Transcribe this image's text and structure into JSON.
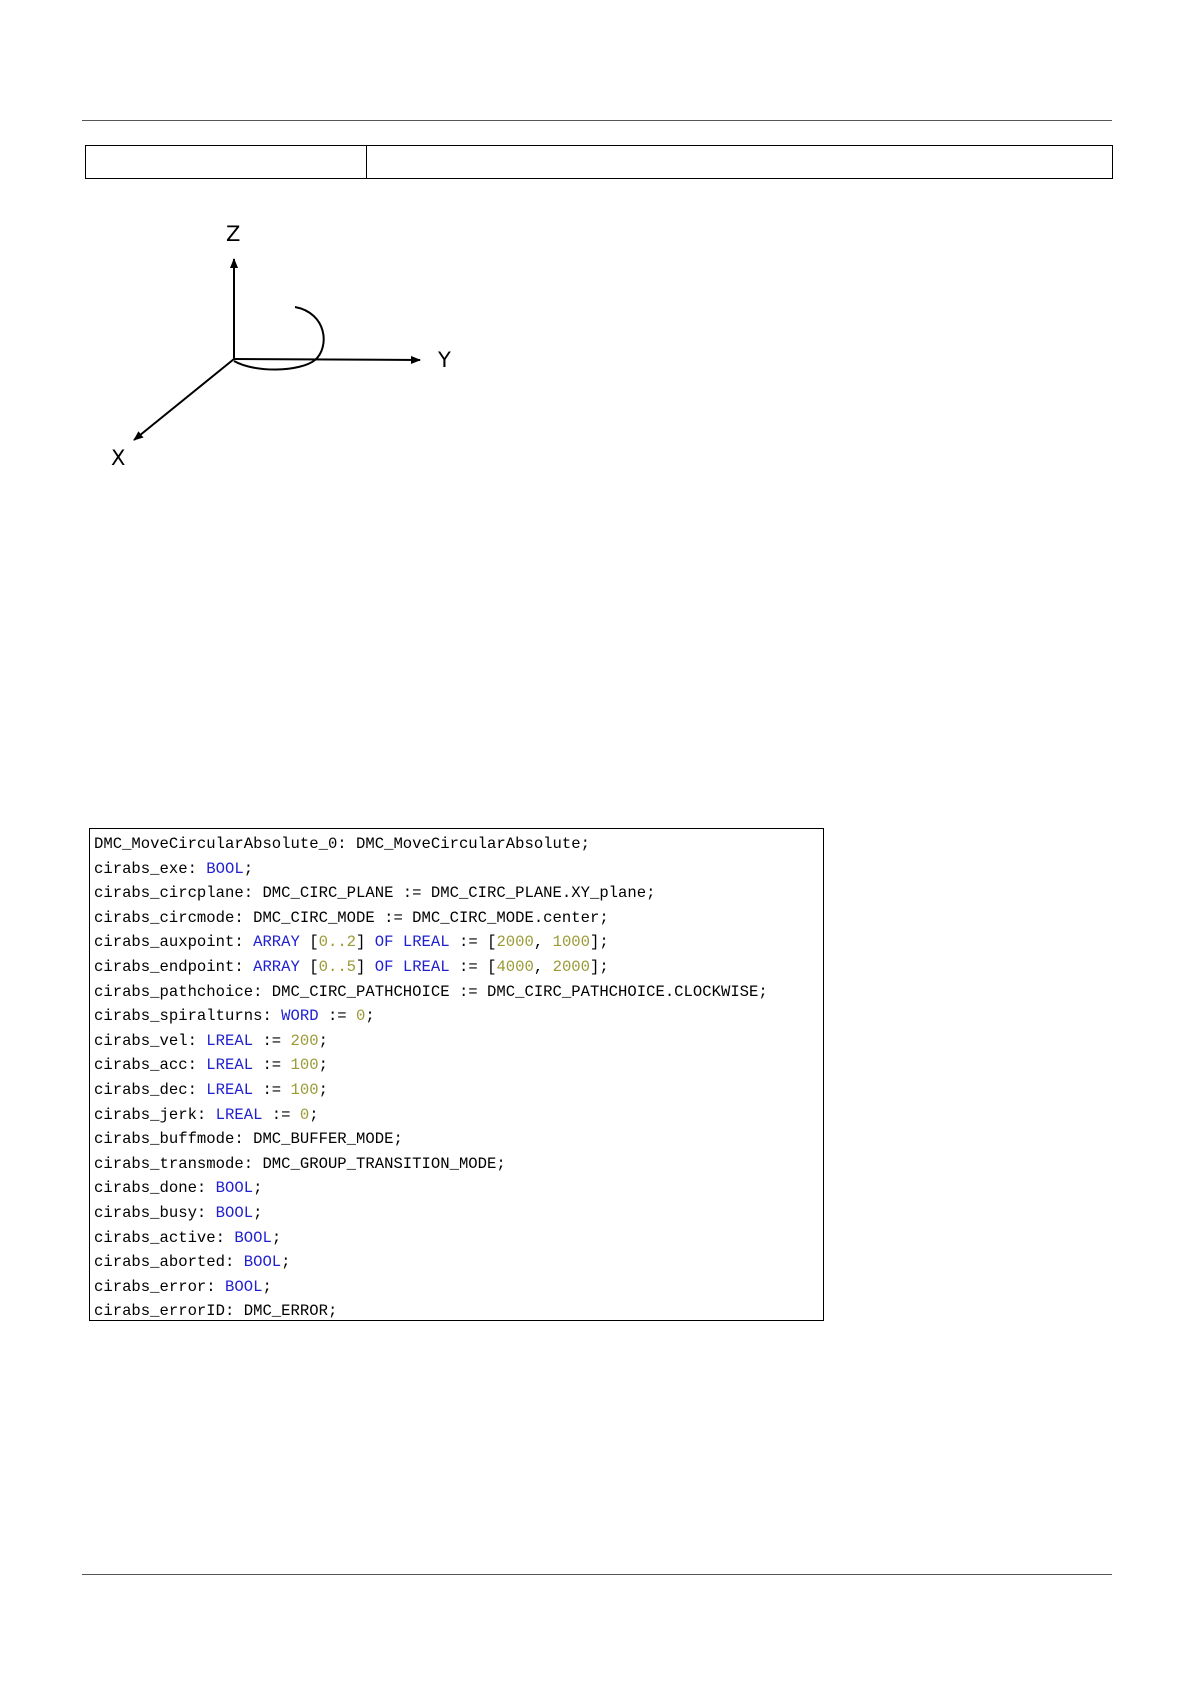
{
  "page": {
    "header_table": {
      "left": "",
      "right": ""
    }
  },
  "diagram": {
    "axes": {
      "z": "Z",
      "y": "Y",
      "x": "X"
    }
  },
  "code": {
    "lines": [
      [
        {
          "t": "DMC_MoveCircularAbsolute_0: DMC_MoveCircularAbsolute;",
          "c": "p"
        }
      ],
      [
        {
          "t": "cirabs_exe: ",
          "c": "p"
        },
        {
          "t": "BOOL",
          "c": "kw"
        },
        {
          "t": ";",
          "c": "p"
        }
      ],
      [
        {
          "t": "cirabs_circplane: DMC_CIRC_PLANE := DMC_CIRC_PLANE.XY_plane;",
          "c": "p"
        }
      ],
      [
        {
          "t": "cirabs_circmode: DMC_CIRC_MODE := DMC_CIRC_MODE.center;",
          "c": "p"
        }
      ],
      [
        {
          "t": "cirabs_auxpoint: ",
          "c": "p"
        },
        {
          "t": "ARRAY",
          "c": "kw"
        },
        {
          "t": " [",
          "c": "p"
        },
        {
          "t": "0..2",
          "c": "num"
        },
        {
          "t": "] ",
          "c": "p"
        },
        {
          "t": "OF",
          "c": "kw"
        },
        {
          "t": " ",
          "c": "p"
        },
        {
          "t": "LREAL",
          "c": "kw"
        },
        {
          "t": " := [",
          "c": "p"
        },
        {
          "t": "2000",
          "c": "num"
        },
        {
          "t": ", ",
          "c": "p"
        },
        {
          "t": "1000",
          "c": "num"
        },
        {
          "t": "];",
          "c": "p"
        }
      ],
      [
        {
          "t": "cirabs_endpoint: ",
          "c": "p"
        },
        {
          "t": "ARRAY",
          "c": "kw"
        },
        {
          "t": " [",
          "c": "p"
        },
        {
          "t": "0..5",
          "c": "num"
        },
        {
          "t": "] ",
          "c": "p"
        },
        {
          "t": "OF",
          "c": "kw"
        },
        {
          "t": " ",
          "c": "p"
        },
        {
          "t": "LREAL",
          "c": "kw"
        },
        {
          "t": " := [",
          "c": "p"
        },
        {
          "t": "4000",
          "c": "num"
        },
        {
          "t": ", ",
          "c": "p"
        },
        {
          "t": "2000",
          "c": "num"
        },
        {
          "t": "];",
          "c": "p"
        }
      ],
      [
        {
          "t": "cirabs_pathchoice: DMC_CIRC_PATHCHOICE := DMC_CIRC_PATHCHOICE.CLOCKWISE;",
          "c": "p"
        }
      ],
      [
        {
          "t": "cirabs_spiralturns: ",
          "c": "p"
        },
        {
          "t": "WORD",
          "c": "kw"
        },
        {
          "t": " := ",
          "c": "p"
        },
        {
          "t": "0",
          "c": "num"
        },
        {
          "t": ";",
          "c": "p"
        }
      ],
      [
        {
          "t": "cirabs_vel: ",
          "c": "p"
        },
        {
          "t": "LREAL",
          "c": "kw"
        },
        {
          "t": " := ",
          "c": "p"
        },
        {
          "t": "200",
          "c": "num"
        },
        {
          "t": ";",
          "c": "p"
        }
      ],
      [
        {
          "t": "cirabs_acc: ",
          "c": "p"
        },
        {
          "t": "LREAL",
          "c": "kw"
        },
        {
          "t": " := ",
          "c": "p"
        },
        {
          "t": "100",
          "c": "num"
        },
        {
          "t": ";",
          "c": "p"
        }
      ],
      [
        {
          "t": "cirabs_dec: ",
          "c": "p"
        },
        {
          "t": "LREAL",
          "c": "kw"
        },
        {
          "t": " := ",
          "c": "p"
        },
        {
          "t": "100",
          "c": "num"
        },
        {
          "t": ";",
          "c": "p"
        }
      ],
      [
        {
          "t": "cirabs_jerk: ",
          "c": "p"
        },
        {
          "t": "LREAL",
          "c": "kw"
        },
        {
          "t": " := ",
          "c": "p"
        },
        {
          "t": "0",
          "c": "num"
        },
        {
          "t": ";",
          "c": "p"
        }
      ],
      [
        {
          "t": "cirabs_buffmode: DMC_BUFFER_MODE;",
          "c": "p"
        }
      ],
      [
        {
          "t": "cirabs_transmode: DMC_GROUP_TRANSITION_MODE;",
          "c": "p"
        }
      ],
      [
        {
          "t": "cirabs_done: ",
          "c": "p"
        },
        {
          "t": "BOOL",
          "c": "kw"
        },
        {
          "t": ";",
          "c": "p"
        }
      ],
      [
        {
          "t": "cirabs_busy: ",
          "c": "p"
        },
        {
          "t": "BOOL",
          "c": "kw"
        },
        {
          "t": ";",
          "c": "p"
        }
      ],
      [
        {
          "t": "cirabs_active: ",
          "c": "p"
        },
        {
          "t": "BOOL",
          "c": "kw"
        },
        {
          "t": ";",
          "c": "p"
        }
      ],
      [
        {
          "t": "cirabs_aborted: ",
          "c": "p"
        },
        {
          "t": "BOOL",
          "c": "kw"
        },
        {
          "t": ";",
          "c": "p"
        }
      ],
      [
        {
          "t": "cirabs_error: ",
          "c": "p"
        },
        {
          "t": "BOOL",
          "c": "kw"
        },
        {
          "t": ";",
          "c": "p"
        }
      ],
      [
        {
          "t": "cirabs_errorID: DMC_ERROR;",
          "c": "p"
        }
      ]
    ]
  },
  "colors": {
    "keyword": "#2020d0",
    "number": "#9a9a35",
    "plain": "#000000"
  }
}
